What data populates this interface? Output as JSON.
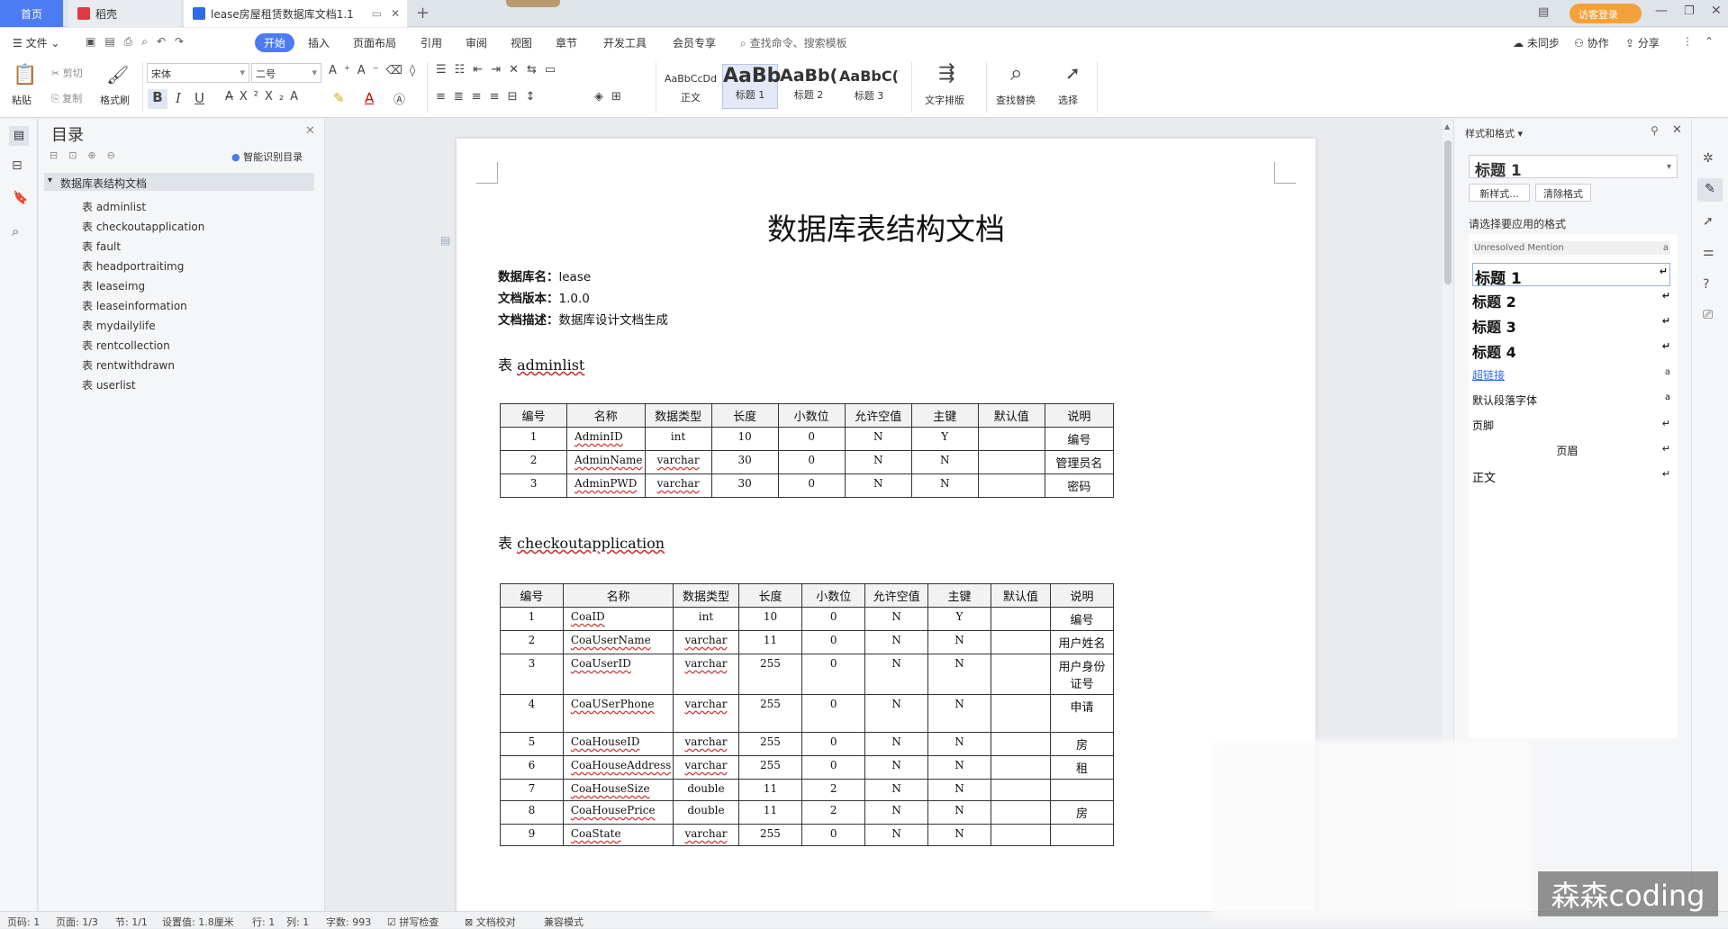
{
  "tabs": {
    "home": "首页",
    "daoke": "稻壳",
    "doc": "lease房屋租赁数据库文档1.1",
    "login": "访客登录"
  },
  "menu": {
    "file": "文件",
    "start": "开始",
    "items": [
      "插入",
      "页面布局",
      "引用",
      "审阅",
      "视图",
      "章节",
      "开发工具",
      "会员专享"
    ],
    "search": "查找命令、搜索模板",
    "sync": "未同步",
    "collab": "协作",
    "share": "分享"
  },
  "ribbon": {
    "paste": "粘贴",
    "cut": "剪切",
    "copy": "复制",
    "format_painter": "格式刷",
    "font": "宋体",
    "size": "二号",
    "styles": [
      {
        "preview": "AaBbCcDd",
        "name": "正文"
      },
      {
        "preview": "AaBb",
        "name": "标题 1"
      },
      {
        "preview": "AaBb(",
        "name": "标题 2"
      },
      {
        "preview": "AaBbC(",
        "name": "标题 3"
      }
    ],
    "text_layout": "文字排版",
    "find_replace": "查找替换",
    "select": "选择"
  },
  "toc": {
    "title": "目录",
    "smart": "智能识别目录",
    "root": "数据库表结构文档",
    "items": [
      "表 adminlist",
      "表 checkoutapplication",
      "表 fault",
      "表 headportraitimg",
      "表 leaseimg",
      "表 leaseinformation",
      "表 mydailylife",
      "表 rentcollection",
      "表 rentwithdrawn",
      "表 userlist"
    ]
  },
  "doc": {
    "title": "数据库表结构文档",
    "meta": [
      {
        "k": "数据库名：",
        "v": "lease"
      },
      {
        "k": "文档版本：",
        "v": "1.0.0"
      },
      {
        "k": "文档描述：",
        "v": "数据库设计文档生成"
      }
    ],
    "headers": [
      "编号",
      "名称",
      "数据类型",
      "长度",
      "小数位",
      "允许空值",
      "主键",
      "默认值",
      "说明"
    ],
    "t1_title_prefix": "表 ",
    "t1_title": "adminlist",
    "t1_rows": [
      [
        "1",
        "AdminID",
        "int",
        "10",
        "0",
        "N",
        "Y",
        "",
        "编号"
      ],
      [
        "2",
        "AdminName",
        "varchar",
        "30",
        "0",
        "N",
        "N",
        "",
        "管理员名"
      ],
      [
        "3",
        "AdminPWD",
        "varchar",
        "30",
        "0",
        "N",
        "N",
        "",
        "密码"
      ]
    ],
    "t2_title_prefix": "表 ",
    "t2_title": "checkoutapplication",
    "t2_rows": [
      [
        "1",
        "CoaID",
        "int",
        "10",
        "0",
        "N",
        "Y",
        "",
        "编号"
      ],
      [
        "2",
        "CoaUserName",
        "varchar",
        "11",
        "0",
        "N",
        "N",
        "",
        "用户姓名"
      ],
      [
        "3",
        "CoaUserID",
        "varchar",
        "255",
        "0",
        "N",
        "N",
        "",
        "用户身份证号"
      ],
      [
        "4",
        "CoaUSerPhone",
        "varchar",
        "255",
        "0",
        "N",
        "N",
        "",
        "申请"
      ],
      [
        "5",
        "CoaHouseID",
        "varchar",
        "255",
        "0",
        "N",
        "N",
        "",
        "房"
      ],
      [
        "6",
        "CoaHouseAddress",
        "varchar",
        "255",
        "0",
        "N",
        "N",
        "",
        "租"
      ],
      [
        "7",
        "CoaHouseSize",
        "double",
        "11",
        "2",
        "N",
        "N",
        "",
        ""
      ],
      [
        "8",
        "CoaHousePrice",
        "double",
        "11",
        "2",
        "N",
        "N",
        "",
        "房"
      ],
      [
        "9",
        "CoaState",
        "varchar",
        "255",
        "0",
        "N",
        "N",
        "",
        ""
      ]
    ]
  },
  "rightpanel": {
    "title": "样式和格式",
    "current": "标题  1",
    "new_style": "新样式...",
    "clear": "清除格式",
    "prompt": "请选择要应用的格式",
    "styles": [
      "Unresolved Mention",
      "标题  1",
      "标题  2",
      "标题  3",
      "标题  4",
      "超链接",
      "默认段落字体",
      "页脚",
      "页眉",
      "正文"
    ]
  },
  "status": {
    "page": "页码: 1",
    "pages": "页面: 1/3",
    "section": "节: 1/1",
    "setting": "设置值: 1.8厘米",
    "row": "行: 1",
    "col": "列: 1",
    "words": "字数: 993",
    "spell": "拼写检查",
    "proof": "文档校对",
    "compat": "兼容模式"
  },
  "watermark": "森森coding"
}
